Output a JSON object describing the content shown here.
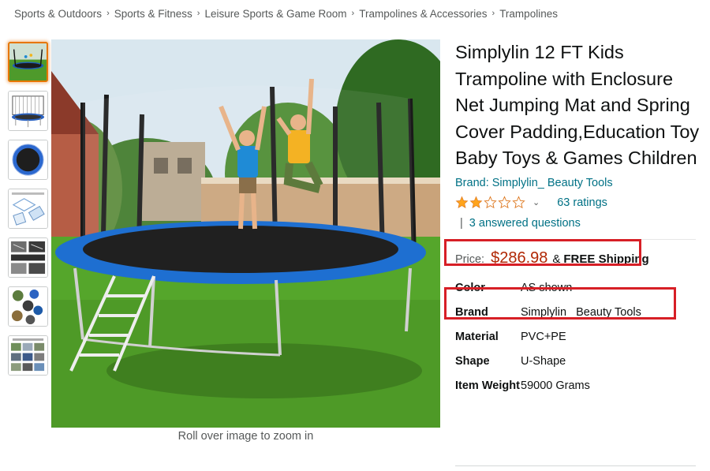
{
  "breadcrumb": [
    "Sports & Outdoors",
    "Sports & Fitness",
    "Leisure Sports & Game Room",
    "Trampolines & Accessories",
    "Trampolines"
  ],
  "breadcrumb_separator": "›",
  "gallery": {
    "thumbnails": [
      {
        "icon": "trampoline-kids-thumbnail",
        "active": true
      },
      {
        "icon": "trampoline-enclosure-thumbnail",
        "active": false
      },
      {
        "icon": "trampoline-top-view-thumbnail",
        "active": false
      },
      {
        "icon": "trampoline-diagram-thumbnail",
        "active": false
      },
      {
        "icon": "trampoline-parts-thumbnail",
        "active": false
      },
      {
        "icon": "trampoline-features-thumbnail",
        "active": false
      },
      {
        "icon": "trampoline-installation-thumbnail",
        "active": false
      }
    ],
    "zoom_hint": "Roll over image to zoom in"
  },
  "product": {
    "title": "Simplylin 12 FT Kids Trampoline with Enclosure Net Jumping Mat and Spring Cover Padding,Education Toy Baby Toys & Games Children",
    "brand_link": "Brand: Simplylin_ Beauty Tools",
    "rating": {
      "stars_value": 2,
      "stars_max": 5,
      "chevron": "⌄",
      "ratings_text": "63 ratings"
    },
    "qa": {
      "separator": "|",
      "text": "3 answered questions"
    },
    "price": {
      "label": "Price:",
      "value": "$286.98",
      "amp": "&",
      "shipping": "FREE Shipping"
    },
    "specs": [
      {
        "key": "Color",
        "value": "AS shown"
      },
      {
        "key": "Brand",
        "value": "Simplylin_ Beauty Tools"
      },
      {
        "key": "Material",
        "value": "PVC+PE"
      },
      {
        "key": "Shape",
        "value": "U-Shape"
      },
      {
        "key": "Item Weight",
        "value": "59000 Grams"
      }
    ]
  },
  "colors": {
    "link": "#007185",
    "price": "#b12704",
    "highlight": "#d71f26",
    "star": "#ffa41c",
    "active_thumb": "#e77600"
  }
}
